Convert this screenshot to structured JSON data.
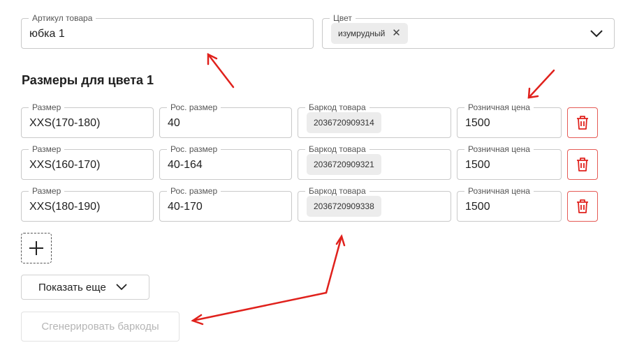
{
  "article": {
    "label": "Артикул товара",
    "value": "юбка 1"
  },
  "color": {
    "label": "Цвет",
    "chip": "изумрудный",
    "icons": {
      "remove": "close-icon",
      "dropdown": "chevron-down-icon"
    }
  },
  "section": {
    "title": "Размеры для цвета 1"
  },
  "labels": {
    "size": "Размер",
    "ru_size": "Рос. размер",
    "barcode": "Баркод товара",
    "price": "Розничная цена"
  },
  "rows": [
    {
      "size": "XXS(170-180)",
      "ru_size": "40",
      "barcode": "2036720909314",
      "price": "1500"
    },
    {
      "size": "XXS(160-170)",
      "ru_size": "40-164",
      "barcode": "2036720909321",
      "price": "1500"
    },
    {
      "size": "XXS(180-190)",
      "ru_size": "40-170",
      "barcode": "2036720909338",
      "price": "1500"
    }
  ],
  "buttons": {
    "show_more": "Показать еще",
    "generate": "Сгенерировать баркоды"
  },
  "colors": {
    "accent_red": "#e0211c",
    "trash_border": "#e55a55"
  }
}
